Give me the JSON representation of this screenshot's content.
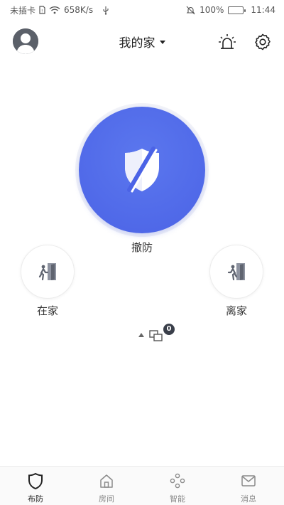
{
  "status_bar": {
    "carrier": "未插卡",
    "net_speed": "658K/s",
    "battery": "100%",
    "time": "11:44"
  },
  "header": {
    "home_name": "我的家"
  },
  "arm_status": {
    "label": "撤防",
    "color": "#4b63e6"
  },
  "modes": {
    "home_label": "在家",
    "away_label": "离家"
  },
  "device_indicator": {
    "count": "0"
  },
  "bottom_nav": {
    "items": [
      {
        "label": "布防",
        "icon": "shield-icon",
        "active": true
      },
      {
        "label": "房间",
        "icon": "home-icon",
        "active": false
      },
      {
        "label": "智能",
        "icon": "smart-icon",
        "active": false
      },
      {
        "label": "消息",
        "icon": "mail-icon",
        "active": false
      }
    ]
  }
}
